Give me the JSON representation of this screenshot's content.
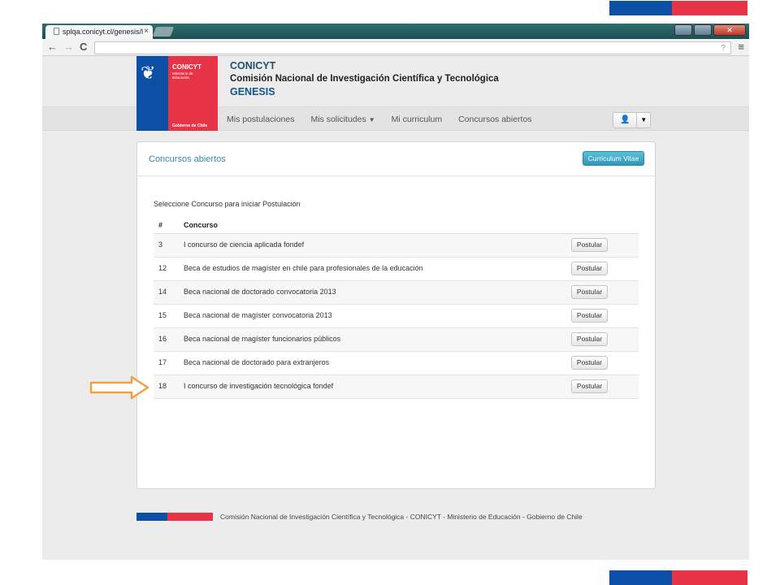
{
  "browser": {
    "tab_title": "splqa.conicyt.cl/genesis/l",
    "tab_close": "×",
    "nav_back": "←",
    "nav_forward": "→",
    "nav_reload": "C",
    "url_hint": "?",
    "menu_glyph": "≡"
  },
  "header": {
    "logo_name": "CONICYT",
    "logo_ministry": "Ministerio de Educación",
    "logo_gov": "Gobierno de Chile",
    "org_short": "CONICYT",
    "org_full": "Comisión Nacional de Investigación Científica y Tecnológica",
    "app_name": "GENESIS"
  },
  "nav": {
    "items": [
      {
        "label": "Mis postulaciones"
      },
      {
        "label": "Mis solicitudes",
        "dropdown": true
      },
      {
        "label": "Mi curriculum"
      },
      {
        "label": "Concursos abiertos"
      }
    ]
  },
  "panel": {
    "title": "Concursos abiertos",
    "cv_button": "Curriculum Vitae",
    "instruction": "Seleccione Concurso para iniciar Postulación",
    "columns": [
      "#",
      "Concurso"
    ],
    "rows": [
      {
        "id": "3",
        "name": "I concurso de ciencia aplicada fondef",
        "action": "Postular"
      },
      {
        "id": "12",
        "name": "Beca de estudios de magíster en chile para profesionales de la educación",
        "action": "Postular"
      },
      {
        "id": "14",
        "name": "Beca nacional de doctorado convocatoria 2013",
        "action": "Postular"
      },
      {
        "id": "15",
        "name": "Beca nacional de magíster convocatoria 2013",
        "action": "Postular"
      },
      {
        "id": "16",
        "name": "Beca nacional de magíster funcionarios públicos",
        "action": "Postular"
      },
      {
        "id": "17",
        "name": "Beca nacional de doctorado para extranjeros",
        "action": "Postular"
      },
      {
        "id": "18",
        "name": "I concurso de investigación tecnológica fondef",
        "action": "Postular"
      }
    ]
  },
  "footer": {
    "text": "Comisión Nacional de Investigación Científica y Tecnológica - CONICYT - Ministerio de Educación - Gobierno de Chile"
  },
  "colors": {
    "flag_blue": "#0b4fa6",
    "flag_red": "#e63446",
    "link_blue": "#3a87ad",
    "arrow_orange": "#f0a040"
  },
  "icons": [
    "document-icon",
    "close-icon",
    "back-arrow-icon",
    "forward-arrow-icon",
    "reload-icon",
    "menu-icon",
    "user-icon",
    "caret-down-icon",
    "pointer-arrow-icon"
  ]
}
